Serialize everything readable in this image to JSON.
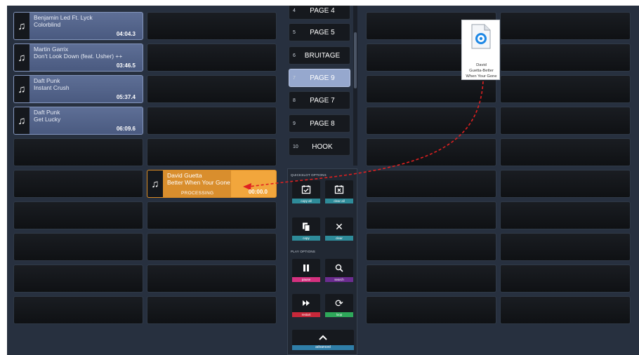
{
  "left_grid": {
    "tracks": [
      {
        "artist": "Benjamin Led Ft. Lyck",
        "title": "Colorblind",
        "duration": "04:04.3",
        "icon": "music-note-icon"
      },
      {
        "artist": "Martin Garrix",
        "title": "Don't Look Down (feat. Usher) ++",
        "duration": "03:46.5",
        "icon": "music-note-icon"
      },
      {
        "artist": "Daft Punk",
        "title": "Instant Crush",
        "duration": "05:37.4",
        "icon": "music-note-icon"
      },
      {
        "artist": "Daft Punk",
        "title": "Get Lucky",
        "duration": "06:09.6",
        "icon": "music-note-icon"
      }
    ],
    "active": {
      "artist": "David Guetta",
      "title": "Better When Your Gone",
      "status": "PROCESSING",
      "time": "00:00.0",
      "progress": 0.6
    }
  },
  "pages": [
    {
      "num": "4",
      "name": "PAGE 4"
    },
    {
      "num": "5",
      "name": "PAGE 5"
    },
    {
      "num": "6",
      "name": "BRUITAGE"
    },
    {
      "num": "7",
      "name": "PAGE 9",
      "selected": true
    },
    {
      "num": "8",
      "name": "PAGE 7"
    },
    {
      "num": "9",
      "name": "PAGE 8"
    },
    {
      "num": "10",
      "name": "HOOK"
    }
  ],
  "quickslot": {
    "section_label": "QUICKSLOT OPTIONS",
    "copy_all": "copy all",
    "clear_all": "clear all",
    "copy": "copy",
    "clear": "clear"
  },
  "play": {
    "section_label": "PLAY OPTIONS",
    "pause": "pause",
    "search": "search",
    "restart": "restart",
    "loop": "loop"
  },
  "advanced_label": "advanced",
  "dragged_file": {
    "name_line1": "David",
    "name_line2": "Guetta-Better",
    "name_line3": "When Your Gone"
  },
  "colors": {
    "track_bg": "#5e6f96",
    "selected_page": "#96a8ce",
    "active_track": "#f2a63c",
    "drag_path": "#e02020"
  }
}
